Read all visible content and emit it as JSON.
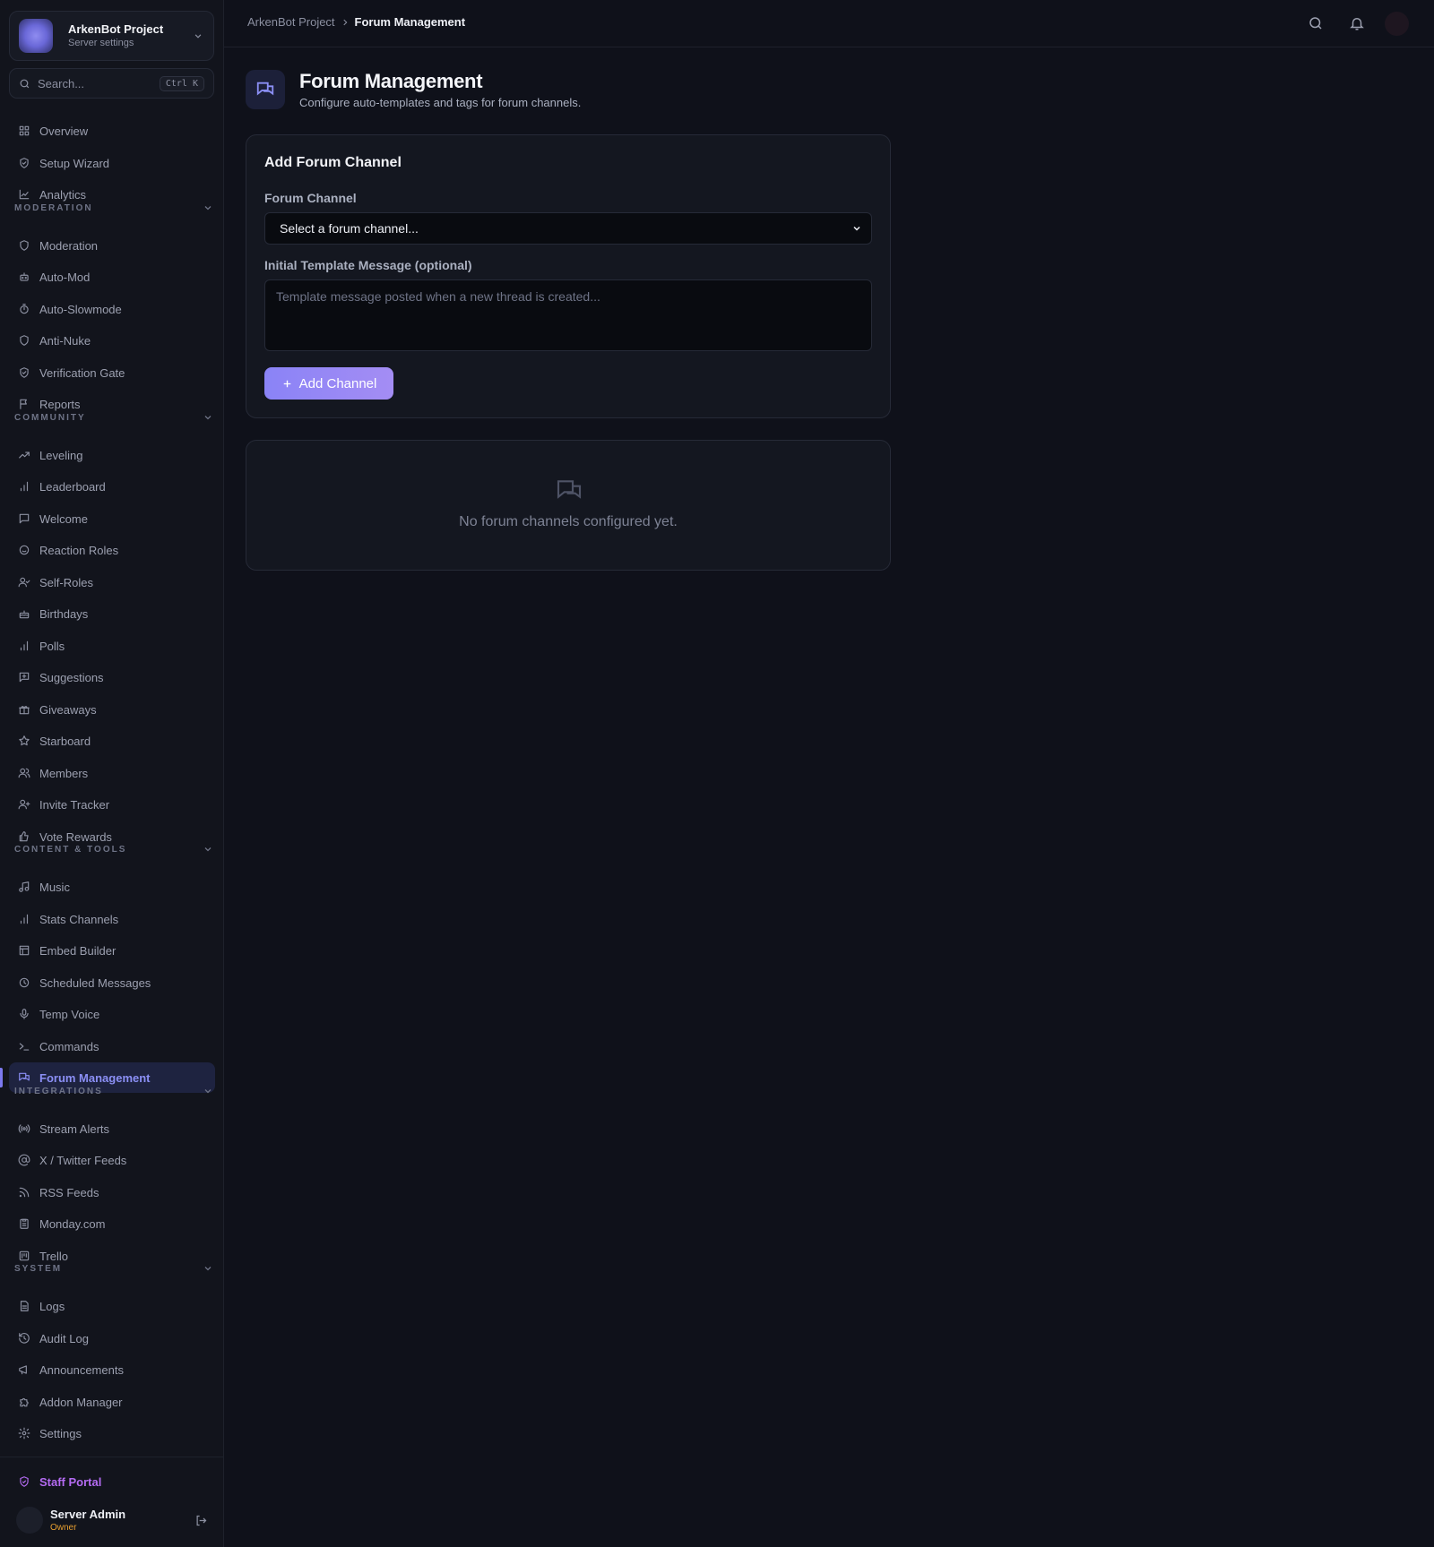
{
  "sidebar": {
    "project": {
      "name": "ArkenBot Project",
      "subtitle": "Server settings"
    },
    "search": {
      "placeholder": "Search...",
      "shortcut": "Ctrl K"
    },
    "items": [
      {
        "label": "Overview",
        "icon": "grid-icon"
      },
      {
        "label": "Setup Wizard",
        "icon": "shield-check-icon"
      },
      {
        "label": "Analytics",
        "icon": "line-chart-icon"
      }
    ],
    "sections": [
      {
        "title": "MODERATION",
        "items": [
          {
            "label": "Moderation",
            "icon": "shield-icon"
          },
          {
            "label": "Auto-Mod",
            "icon": "bot-icon"
          },
          {
            "label": "Auto-Slowmode",
            "icon": "timer-icon"
          },
          {
            "label": "Anti-Nuke",
            "icon": "shield-icon"
          },
          {
            "label": "Verification Gate",
            "icon": "shield-check-icon"
          },
          {
            "label": "Reports",
            "icon": "flag-icon"
          }
        ]
      },
      {
        "title": "COMMUNITY",
        "items": [
          {
            "label": "Leveling",
            "icon": "trending-up-icon"
          },
          {
            "label": "Leaderboard",
            "icon": "bar-chart-icon"
          },
          {
            "label": "Welcome",
            "icon": "message-square-icon"
          },
          {
            "label": "Reaction Roles",
            "icon": "smile-icon"
          },
          {
            "label": "Self-Roles",
            "icon": "user-check-icon"
          },
          {
            "label": "Birthdays",
            "icon": "cake-icon"
          },
          {
            "label": "Polls",
            "icon": "bar-chart-icon"
          },
          {
            "label": "Suggestions",
            "icon": "message-plus-icon"
          },
          {
            "label": "Giveaways",
            "icon": "gift-icon"
          },
          {
            "label": "Starboard",
            "icon": "star-icon"
          },
          {
            "label": "Members",
            "icon": "users-icon"
          },
          {
            "label": "Invite Tracker",
            "icon": "user-plus-icon"
          },
          {
            "label": "Vote Rewards",
            "icon": "thumbs-up-icon"
          }
        ]
      },
      {
        "title": "CONTENT & TOOLS",
        "items": [
          {
            "label": "Music",
            "icon": "music-icon"
          },
          {
            "label": "Stats Channels",
            "icon": "bar-chart-icon"
          },
          {
            "label": "Embed Builder",
            "icon": "layout-icon"
          },
          {
            "label": "Scheduled Messages",
            "icon": "clock-icon"
          },
          {
            "label": "Temp Voice",
            "icon": "mic-icon"
          },
          {
            "label": "Commands",
            "icon": "terminal-icon"
          },
          {
            "label": "Forum Management",
            "icon": "messages-icon",
            "active": true
          }
        ]
      },
      {
        "title": "INTEGRATIONS",
        "items": [
          {
            "label": "Stream Alerts",
            "icon": "radio-icon"
          },
          {
            "label": "X / Twitter Feeds",
            "icon": "at-sign-icon"
          },
          {
            "label": "RSS Feeds",
            "icon": "rss-icon"
          },
          {
            "label": "Monday.com",
            "icon": "clipboard-icon"
          },
          {
            "label": "Trello",
            "icon": "kanban-icon"
          }
        ]
      },
      {
        "title": "SYSTEM",
        "items": [
          {
            "label": "Logs",
            "icon": "file-text-icon"
          },
          {
            "label": "Audit Log",
            "icon": "history-icon"
          },
          {
            "label": "Announcements",
            "icon": "megaphone-icon"
          },
          {
            "label": "Addon Manager",
            "icon": "puzzle-icon"
          },
          {
            "label": "Settings",
            "icon": "gear-icon"
          }
        ]
      }
    ],
    "staff_portal": "Staff Portal",
    "user": {
      "name": "Server Admin",
      "role": "Owner"
    }
  },
  "breadcrumb": {
    "root": "ArkenBot Project",
    "current": "Forum Management"
  },
  "page": {
    "title": "Forum Management",
    "subtitle": "Configure auto-templates and tags for forum channels."
  },
  "form": {
    "title": "Add Forum Channel",
    "channel_label": "Forum Channel",
    "channel_value": "Select a forum channel...",
    "template_label": "Initial Template Message (optional)",
    "template_placeholder": "Template message posted when a new thread is created...",
    "add_button": "Add Channel"
  },
  "empty_state": {
    "text": "No forum channels configured yet."
  },
  "colors": {
    "accent": "#8b8ff5",
    "staff": "#b46bf2",
    "owner": "#e59d2f",
    "background": "#0f111a"
  }
}
